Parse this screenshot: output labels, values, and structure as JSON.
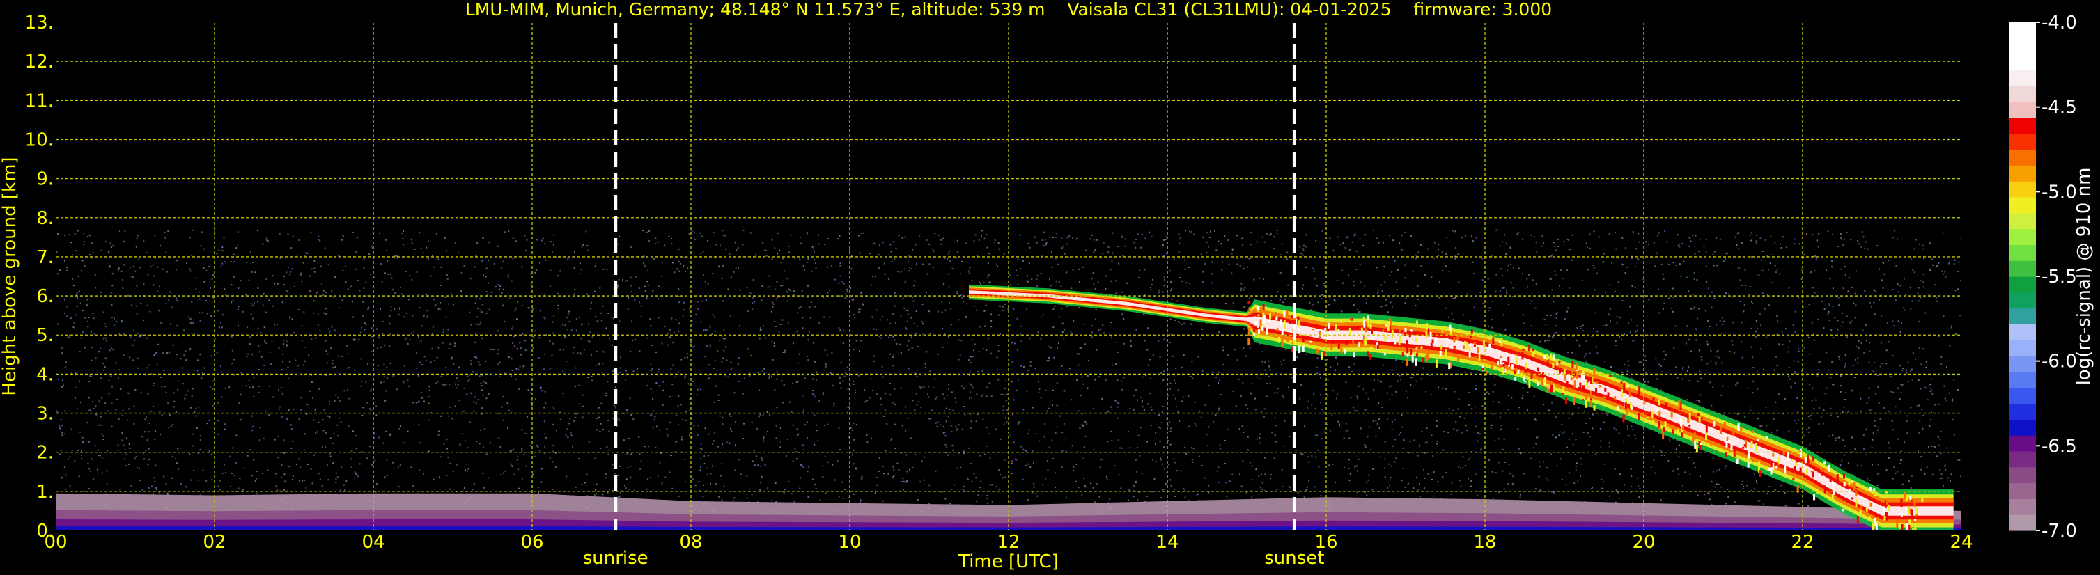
{
  "chart_data": {
    "type": "heatmap",
    "title": "LMU-MIM, Munich, Germany; 48.148° N 11.573° E, altitude: 539 m    Vaisala CL31 (CL31LMU): 04-01-2025    firmware: 3.000",
    "xlabel": "Time [UTC]",
    "ylabel": "Height above ground [km]",
    "xlim": [
      0,
      24
    ],
    "ylim": [
      0,
      13
    ],
    "x_ticks": [
      "00",
      "02",
      "04",
      "06",
      "08",
      "10",
      "12",
      "14",
      "16",
      "18",
      "20",
      "22",
      "24"
    ],
    "y_ticks": [
      "0.",
      "1.",
      "2.",
      "3.",
      "4.",
      "5.",
      "6.",
      "7.",
      "8.",
      "9.",
      "10.",
      "11.",
      "12.",
      "13."
    ],
    "grid": true,
    "grid_color": "#c8c800",
    "measurement_top_km": 7.7,
    "annotations": [
      {
        "label": "sunrise",
        "time": 7.05
      },
      {
        "label": "sunset",
        "time": 15.6
      }
    ],
    "colorbar": {
      "label": "log(rc-signal) @ 910 nm",
      "ticks": [
        "-4.0",
        "-4.5",
        "-5.0",
        "-5.5",
        "-6.0",
        "-6.5",
        "-7.0"
      ],
      "range": [
        -7.0,
        -4.0
      ],
      "colors": [
        "#b09aaa",
        "#a8809e",
        "#9a6690",
        "#8a4c86",
        "#7a2c84",
        "#680c88",
        "#1010c8",
        "#2030e0",
        "#3a58f0",
        "#5a7af4",
        "#7a96f4",
        "#9ab0f8",
        "#b0c0f8",
        "#30a0a0",
        "#10a060",
        "#10a040",
        "#40c040",
        "#70e040",
        "#a0f040",
        "#d0f040",
        "#f0f020",
        "#f8d010",
        "#f8a000",
        "#f87000",
        "#f83000",
        "#f00000",
        "#f0c0c0",
        "#f0d8d8",
        "#f8f0f0",
        "#ffffff",
        "#ffffff",
        "#ffffff"
      ]
    },
    "series": [
      {
        "layer": "boundary_layer_aerosol",
        "x": [
          0,
          2,
          4,
          6,
          8,
          10,
          12,
          14,
          16,
          18,
          20,
          22,
          24
        ],
        "top_km": [
          0.95,
          0.9,
          0.95,
          0.95,
          0.75,
          0.7,
          0.65,
          0.75,
          0.85,
          0.8,
          0.7,
          0.6,
          0.5
        ],
        "colors": [
          "#b090a8",
          "#8a4c86",
          "#680c88",
          "#1010c8"
        ]
      },
      {
        "layer": "cloud_base",
        "x": [
          11.5,
          12.5,
          13.5,
          14.5,
          15.0,
          15.5,
          16.0,
          16.5,
          17.0,
          17.5,
          18.0,
          18.5,
          19.0,
          19.5,
          20.0,
          20.5,
          21.0,
          21.5,
          22.0,
          22.5,
          23.0,
          23.5,
          24.0
        ],
        "y_km": [
          6.1,
          6.0,
          5.8,
          5.5,
          5.4,
          5.2,
          5.0,
          5.0,
          4.9,
          4.8,
          4.6,
          4.3,
          3.9,
          3.6,
          3.2,
          2.8,
          2.4,
          2.0,
          1.6,
          1.0,
          0.5,
          0.5,
          0.5
        ]
      }
    ]
  }
}
